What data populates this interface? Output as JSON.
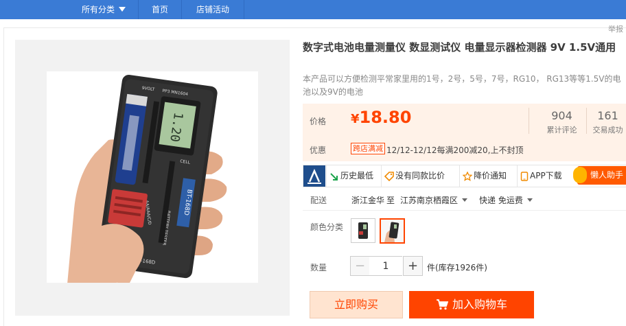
{
  "nav": {
    "categories_label": "所有分类",
    "home_label": "首页",
    "store_events_label": "店铺活动"
  },
  "report_label": "举报",
  "product": {
    "title": "数字式电池电量测量仪 数显测试仪 电量显示器检测器 9V 1.5V通用",
    "description": "本产品可以方便检测平常家里用的1号，2号，5号，7号，RG10， RG13等等1.5V的电池以及9V的电池",
    "image_texts": {
      "display": "1.20",
      "label_9volt": "9VOLT",
      "label_pp3": "PP3 MN1604",
      "label_cell": "CELL",
      "label_aa": "AA/AAA/C/D",
      "model_stripe": "BT-168D",
      "model_bottom": "BT-168D",
      "side_text": "BATTERY TESTER"
    }
  },
  "price": {
    "label": "价格",
    "currency": "¥",
    "value": "18.80",
    "reviews_count": "904",
    "reviews_label": "累计评论",
    "sales_count": "161",
    "sales_label": "交易成功"
  },
  "promo": {
    "label": "优惠",
    "badge": "跨店满减",
    "text": "12/12-12/12每满200减20,上不封顶"
  },
  "toolbar": {
    "history_low": "历史最低",
    "no_compare": "没有同款比价",
    "price_alert": "降价通知",
    "app_download": "APP下载",
    "helper": "懒人助手"
  },
  "shipping": {
    "label": "配送",
    "origin": "浙江金华",
    "to": "至",
    "destination": "江苏南京栖霞区",
    "method": "快递 免运费"
  },
  "color": {
    "label": "颜色分类"
  },
  "quantity": {
    "label": "数量",
    "value": "1",
    "minus": "−",
    "plus": "+",
    "stock": "件(库存1926件)"
  },
  "actions": {
    "buy_now": "立即购买",
    "add_to_cart": "加入购物车"
  },
  "colors": {
    "accent": "#ff4400",
    "nav_bg": "#3a7bd5",
    "price_bg": "#fff2e8"
  }
}
